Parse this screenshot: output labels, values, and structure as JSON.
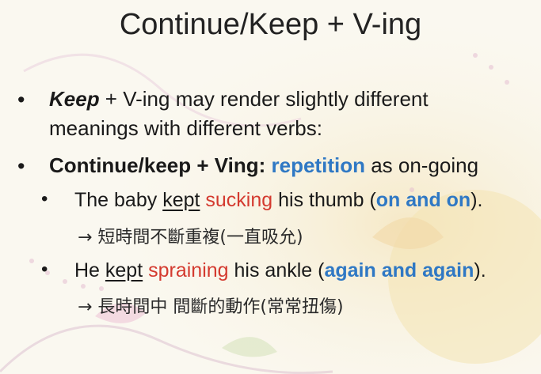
{
  "slide": {
    "title": "Continue/Keep + V-ing",
    "bullet1": {
      "keyword": "Keep",
      "rest": " + V-ing may render slightly different",
      "line2": "meanings with different verbs:"
    },
    "bullet2": {
      "bold": "Continue/keep + Ving:",
      "highlight": "repetition",
      "rest": " as on-going"
    },
    "ex1": {
      "pre": "The baby ",
      "kept": "kept",
      "verb": "sucking",
      "mid": " his thumb (",
      "phrase": "on and on",
      "post": ").",
      "gloss": "→ 短時間不斷重複(一直吸允)"
    },
    "ex2": {
      "pre": "He ",
      "kept": "kept",
      "verb": "spraining",
      "mid": " his ankle (",
      "phrase": "again and again",
      "post": ").",
      "gloss": "→ 長時間中 間斷的動作(常常扭傷)"
    },
    "bullet_char": "•"
  }
}
